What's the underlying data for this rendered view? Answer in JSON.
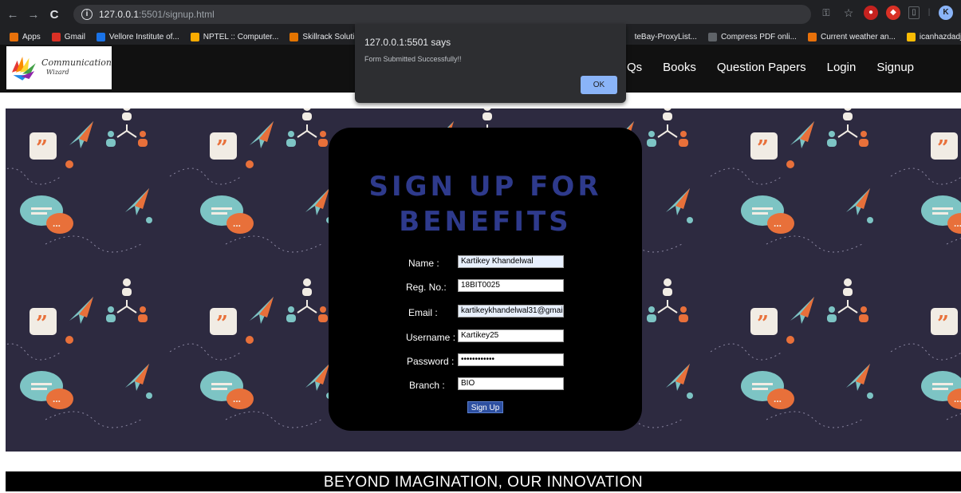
{
  "browser": {
    "url_host": "127.0.0.1",
    "url_path": ":5501/signup.html",
    "bookmarks": [
      {
        "label": "Apps",
        "color": "#e8710a"
      },
      {
        "label": "Gmail",
        "color": "#d93025"
      },
      {
        "label": "Vellore Institute of...",
        "color": "#1a73e8"
      },
      {
        "label": "NPTEL :: Computer...",
        "color": "#f9ab00"
      },
      {
        "label": "Skillrack Solution",
        "color": "#e37400"
      },
      {
        "label": "teBay-ProxyList...",
        "color": "#202124"
      },
      {
        "label": "Compress PDF onli...",
        "color": "#5f6368"
      },
      {
        "label": "Current weather an...",
        "color": "#e8710a"
      },
      {
        "label": "icanhazdadjoke",
        "color": "#fbbc04"
      }
    ]
  },
  "dialog": {
    "title": "127.0.0.1:5501 says",
    "message": "Form Submitted Successfully!!",
    "ok_label": "OK"
  },
  "site": {
    "logo_line1": "Communication",
    "logo_line2": "Wizard",
    "nav": [
      "Qs",
      "Books",
      "Question Papers",
      "Login",
      "Signup"
    ]
  },
  "form": {
    "title_line1": "SIGN UP FOR",
    "title_line2": "BENEFITS",
    "fields": [
      {
        "label": "Name :",
        "value": "Kartikey Khandelwal"
      },
      {
        "label": "Reg. No.:",
        "value": "18BIT0025"
      },
      {
        "label": "Email :",
        "value": "kartikeykhandelwal31@gmai"
      },
      {
        "label": "Username :",
        "value": "Kartikey25"
      },
      {
        "label": "Password :",
        "value": "••••••••••••"
      },
      {
        "label": "Branch :",
        "value": "BIO"
      }
    ],
    "submit_label": "Sign Up"
  },
  "footer": {
    "tagline": "BEYOND IMAGINATION, OUR INNOVATION"
  },
  "colors": {
    "hero_bg": "#2d2a40",
    "accent_orange": "#e8703a",
    "accent_teal": "#7dc4c4",
    "title_blue": "#2e3a8c"
  }
}
